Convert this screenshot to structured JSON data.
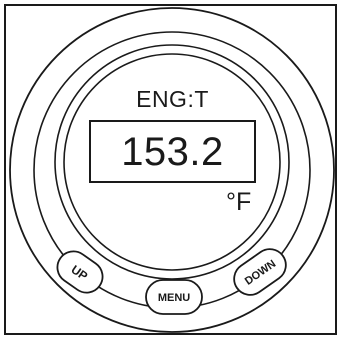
{
  "display": {
    "mode_label": "ENG:T",
    "reading_value": "153.2",
    "unit_label": "°F"
  },
  "buttons": {
    "up_label": "UP",
    "menu_label": "MENU",
    "down_label": "DOWN"
  },
  "colors": {
    "stroke": "#1a1a1a",
    "background": "#ffffff"
  }
}
